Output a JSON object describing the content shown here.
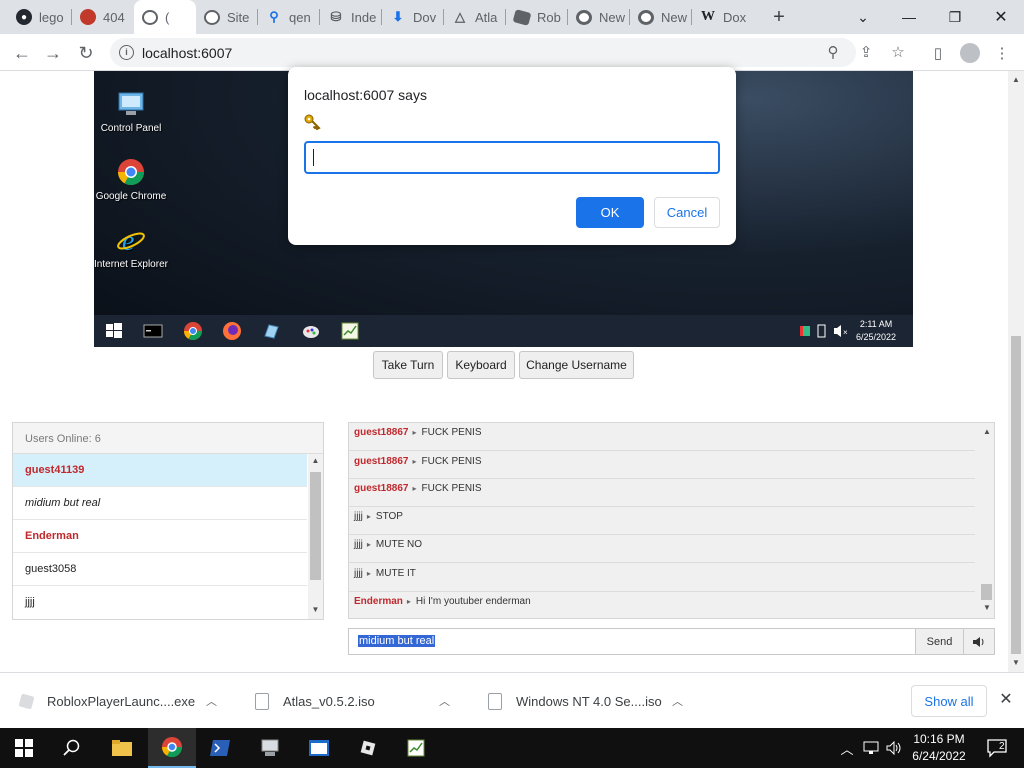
{
  "browser": {
    "tabs": [
      {
        "label": "lego",
        "icon": "github-icon",
        "color": "#24292f"
      },
      {
        "label": "404",
        "icon": "site-icon",
        "color": "#c0392b"
      },
      {
        "label": "(",
        "icon": "globe-icon",
        "color": "#5f6368",
        "active": true
      },
      {
        "label": "Site",
        "icon": "globe-icon",
        "color": "#5f6368"
      },
      {
        "label": "qen",
        "icon": "search-icon",
        "color": "#1a73e8"
      },
      {
        "label": "Inde",
        "icon": "archive-icon",
        "color": "#5f6368"
      },
      {
        "label": "Dov",
        "icon": "download-icon",
        "color": "#1a73e8"
      },
      {
        "label": "Atla",
        "icon": "atlas-icon",
        "color": "#5f6368"
      },
      {
        "label": "Rob",
        "icon": "roblox-icon",
        "color": "#5f6368"
      },
      {
        "label": "New",
        "icon": "chrome-icon",
        "color": "#5f6368"
      },
      {
        "label": "New",
        "icon": "chrome-icon",
        "color": "#5f6368"
      },
      {
        "label": "Dox",
        "icon": "wikipedia-icon",
        "color": "#202124"
      }
    ],
    "url": "localhost:6007"
  },
  "vm": {
    "desktop_icons": [
      {
        "label": "Control Panel",
        "icon": "control-panel-icon"
      },
      {
        "label": "Google Chrome",
        "icon": "chrome-icon"
      },
      {
        "label": "Internet Explorer",
        "icon": "ie-icon"
      }
    ],
    "clock_time": "2:11 AM",
    "clock_date": "6/25/2022"
  },
  "actions": {
    "take_turn": "Take Turn",
    "keyboard": "Keyboard",
    "change_username": "Change Username"
  },
  "users": {
    "header": "Users Online: 6",
    "list": [
      {
        "name": "guest41139",
        "style": "highlight"
      },
      {
        "name": "midium but real",
        "style": "italic"
      },
      {
        "name": "Enderman",
        "style": "admin"
      },
      {
        "name": "guest3058",
        "style": "normal"
      },
      {
        "name": "jjjj",
        "style": "normal"
      }
    ]
  },
  "chat": {
    "messages": [
      {
        "user": "guest18867",
        "text": "FUCK PENIS",
        "color": "#c0282c"
      },
      {
        "user": "guest18867",
        "text": "FUCK PENIS",
        "color": "#c0282c"
      },
      {
        "user": "guest18867",
        "text": "FUCK PENIS",
        "color": "#c0282c"
      },
      {
        "user": "jjjj",
        "text": "STOP",
        "color": "#333333"
      },
      {
        "user": "jjjj",
        "text": "MUTE NO",
        "color": "#333333"
      },
      {
        "user": "jjjj",
        "text": "MUTE IT",
        "color": "#333333"
      },
      {
        "user": "Enderman",
        "text": "Hi I'm youtuber enderman",
        "color": "#c0282c"
      }
    ],
    "input_value": "midium but real",
    "send_label": "Send",
    "sound_icon": "speaker-icon"
  },
  "dialog": {
    "title": "localhost:6007 says",
    "icon": "key-icon",
    "input_value": "",
    "ok_label": "OK",
    "cancel_label": "Cancel"
  },
  "downloads": {
    "items": [
      {
        "name": "RobloxPlayerLaunc....exe"
      },
      {
        "name": "Atlas_v0.5.2.iso"
      },
      {
        "name": "Windows NT 4.0 Se....iso"
      }
    ],
    "show_all": "Show all"
  },
  "taskbar": {
    "time": "10:16 PM",
    "date": "6/24/2022",
    "notification_count": "2"
  },
  "colors": {
    "accent": "#1a73e8",
    "admin_red": "#c0282c",
    "selected_row": "#d6f0fb"
  }
}
